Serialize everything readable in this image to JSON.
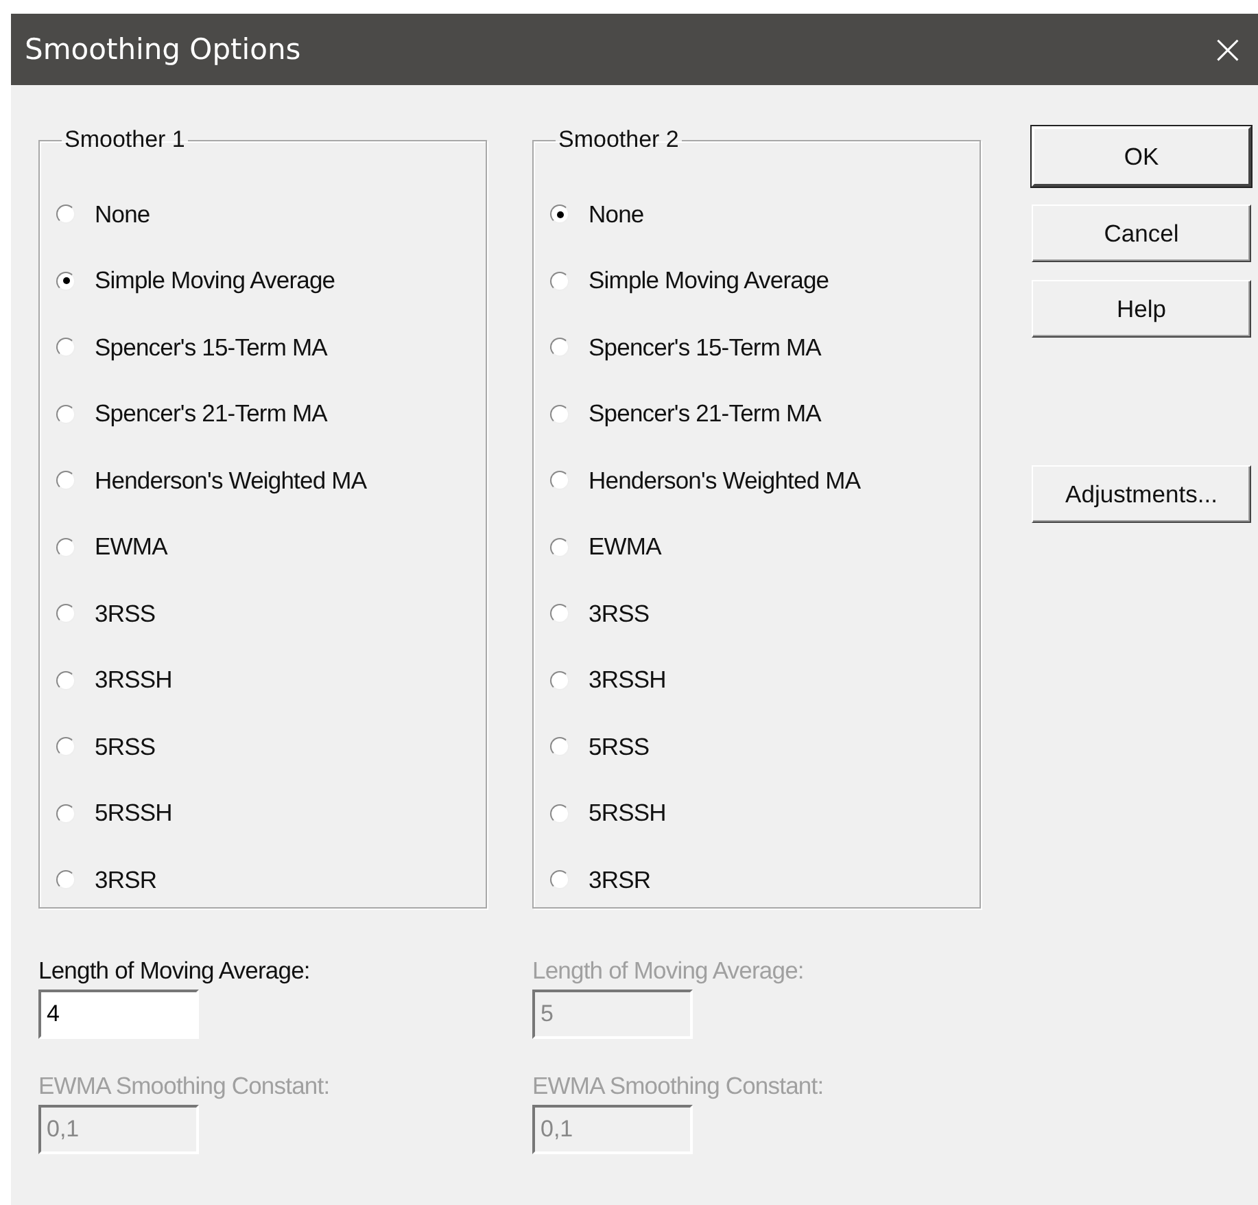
{
  "window": {
    "title": "Smoothing Options",
    "close": "×"
  },
  "smoothers": [
    {
      "title": "Smoother 1",
      "options": [
        {
          "label": "None",
          "selected": false
        },
        {
          "label": "Simple Moving Average",
          "selected": true
        },
        {
          "label": "Spencer's 15-Term MA",
          "selected": false
        },
        {
          "label": "Spencer's 21-Term MA",
          "selected": false
        },
        {
          "label": "Henderson's Weighted MA",
          "selected": false
        },
        {
          "label": "EWMA",
          "selected": false
        },
        {
          "label": "3RSS",
          "selected": false
        },
        {
          "label": "3RSSH",
          "selected": false
        },
        {
          "label": "5RSS",
          "selected": false
        },
        {
          "label": "5RSSH",
          "selected": false
        },
        {
          "label": "3RSR",
          "selected": false
        }
      ],
      "fields": [
        {
          "label": "Length of Moving Average:",
          "value": "4",
          "disabled": false
        },
        {
          "label": "EWMA Smoothing Constant:",
          "value": "0,1",
          "disabled": true
        }
      ]
    },
    {
      "title": "Smoother 2",
      "options": [
        {
          "label": "None",
          "selected": true
        },
        {
          "label": "Simple Moving Average",
          "selected": false
        },
        {
          "label": "Spencer's 15-Term MA",
          "selected": false
        },
        {
          "label": "Spencer's 21-Term MA",
          "selected": false
        },
        {
          "label": "Henderson's Weighted MA",
          "selected": false
        },
        {
          "label": "EWMA",
          "selected": false
        },
        {
          "label": "3RSS",
          "selected": false
        },
        {
          "label": "3RSSH",
          "selected": false
        },
        {
          "label": "5RSS",
          "selected": false
        },
        {
          "label": "5RSSH",
          "selected": false
        },
        {
          "label": "3RSR",
          "selected": false
        }
      ],
      "fields": [
        {
          "label": "Length of Moving Average:",
          "value": "5",
          "disabled": true
        },
        {
          "label": "EWMA Smoothing Constant:",
          "value": "0,1",
          "disabled": true
        }
      ]
    }
  ],
  "buttons": [
    {
      "label": "OK",
      "kind": "default"
    },
    {
      "label": "Cancel",
      "kind": "normal"
    },
    {
      "label": "Help",
      "kind": "normal"
    },
    {
      "label": "Adjustments...",
      "kind": "spaced"
    }
  ]
}
